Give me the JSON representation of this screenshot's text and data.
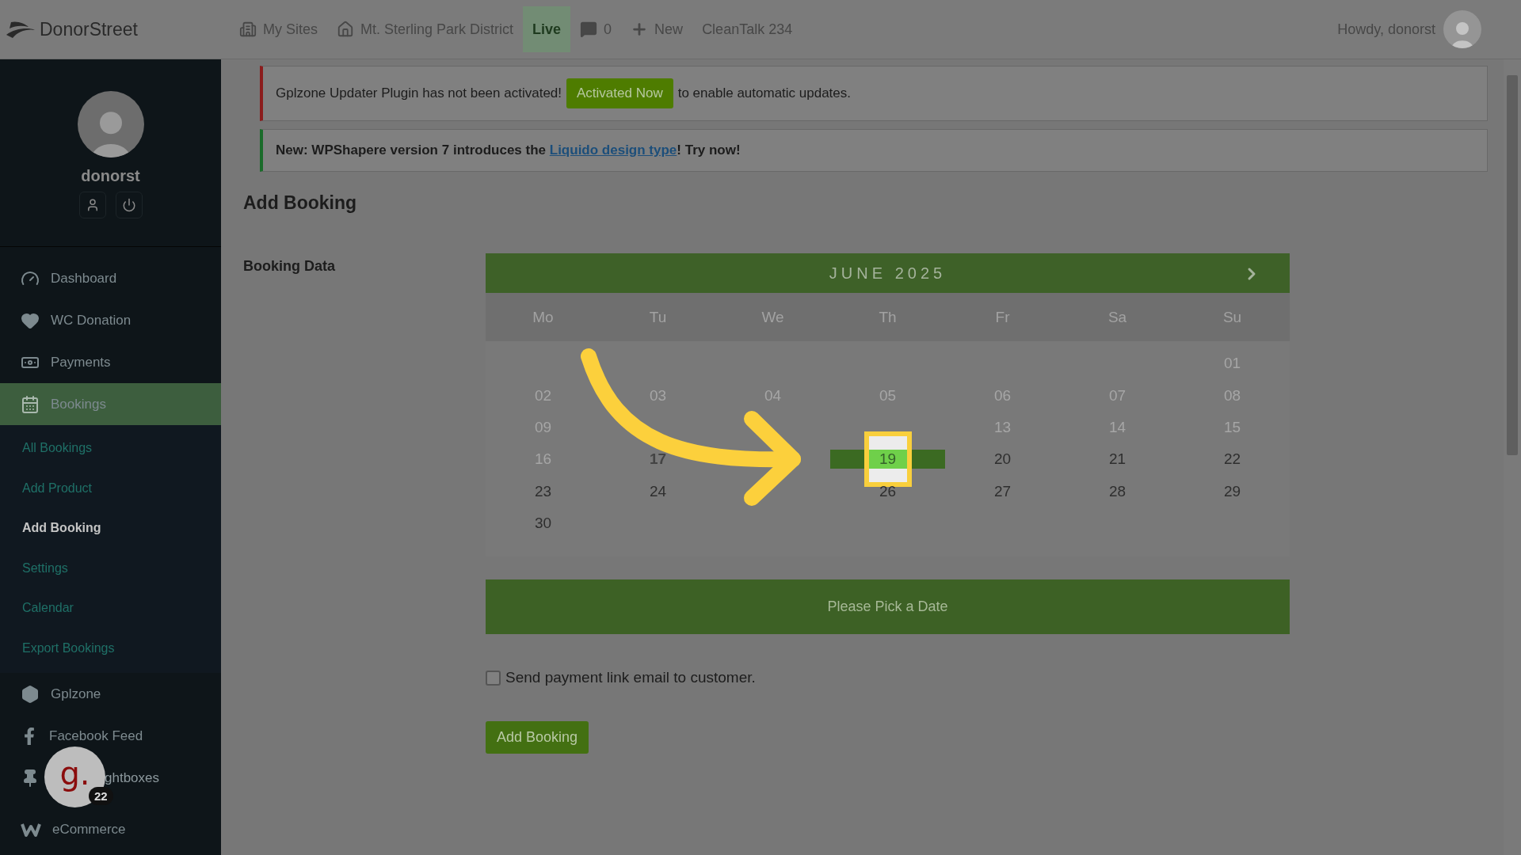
{
  "topbar": {
    "logo": "DonorStreet",
    "items": [
      {
        "kind": "sites",
        "label": "My Sites"
      },
      {
        "kind": "home",
        "label": "Mt. Sterling Park District"
      },
      {
        "kind": "live",
        "label": "Live"
      },
      {
        "kind": "comments",
        "label": "0"
      },
      {
        "kind": "new",
        "label": "New"
      },
      {
        "kind": "plain",
        "label": "CleanTalk 234"
      }
    ],
    "greeting": "Howdy, donorst"
  },
  "sidebar": {
    "username": "donorst",
    "items": [
      {
        "kind": "dashboard",
        "label": "Dashboard",
        "selected": false,
        "under_badge": false
      },
      {
        "kind": "heart",
        "label": "WC Donation",
        "selected": false,
        "under_badge": false
      },
      {
        "kind": "payments",
        "label": "Payments",
        "selected": false,
        "under_badge": false
      },
      {
        "kind": "calendar",
        "label": "Bookings",
        "selected": true,
        "under_badge": false,
        "children": [
          {
            "label": "All Bookings",
            "selected": false
          },
          {
            "label": "Add Product",
            "selected": false
          },
          {
            "label": "Add Booking",
            "selected": true
          },
          {
            "label": "Settings",
            "selected": false
          },
          {
            "label": "Calendar",
            "selected": false
          },
          {
            "label": "Export Bookings",
            "selected": false
          }
        ]
      },
      {
        "kind": "hexagon",
        "label": "Gplzone",
        "selected": false,
        "under_badge": false
      },
      {
        "kind": "facebook",
        "label": "Facebook Feed",
        "selected": false,
        "under_badge": false
      },
      {
        "kind": "pin",
        "label": "ghtboxes",
        "selected": false,
        "under_badge": true
      },
      {
        "kind": "woo",
        "label": "eCommerce",
        "selected": false,
        "under_badge": false
      }
    ]
  },
  "chat_bubble": {
    "logo": "g.",
    "badge": "22"
  },
  "notices": [
    {
      "kind": "error",
      "text": "Gplzone Updater Plugin has not been activated!",
      "button": "Activated Now",
      "after": "to enable automatic updates."
    },
    {
      "kind": "success",
      "text": "New: WPShapere version 7 introduces the ",
      "link": "Liquido design type",
      "after": "! Try now!"
    }
  ],
  "page": {
    "title": "Add Booking",
    "field_label": "Booking Data"
  },
  "calendar": {
    "month": "JUNE 2025",
    "weekdays": [
      "Mo",
      "Tu",
      "We",
      "Th",
      "Fr",
      "Sa",
      "Su"
    ],
    "weeks": [
      [
        {
          "kind": "blank"
        },
        {
          "kind": "blank"
        },
        {
          "kind": "blank"
        },
        {
          "kind": "blank"
        },
        {
          "kind": "blank"
        },
        {
          "kind": "blank"
        },
        {
          "kind": "day",
          "day": "01",
          "disabled": true,
          "today": false,
          "selected": false
        }
      ],
      [
        {
          "kind": "day",
          "day": "02",
          "disabled": true,
          "today": false,
          "selected": false
        },
        {
          "kind": "day",
          "day": "03",
          "disabled": true,
          "today": false,
          "selected": false
        },
        {
          "kind": "day",
          "day": "04",
          "disabled": true,
          "today": false,
          "selected": false
        },
        {
          "kind": "day",
          "day": "05",
          "disabled": true,
          "today": false,
          "selected": false
        },
        {
          "kind": "day",
          "day": "06",
          "disabled": true,
          "today": false,
          "selected": false
        },
        {
          "kind": "day",
          "day": "07",
          "disabled": true,
          "today": false,
          "selected": false
        },
        {
          "kind": "day",
          "day": "08",
          "disabled": true,
          "today": false,
          "selected": false
        }
      ],
      [
        {
          "kind": "day",
          "day": "09",
          "disabled": true,
          "today": false,
          "selected": false
        },
        {
          "kind": "blank"
        },
        {
          "kind": "blank"
        },
        {
          "kind": "blank"
        },
        {
          "kind": "day",
          "day": "13",
          "disabled": true,
          "today": false,
          "selected": false
        },
        {
          "kind": "day",
          "day": "14",
          "disabled": true,
          "today": false,
          "selected": false
        },
        {
          "kind": "day",
          "day": "15",
          "disabled": true,
          "today": false,
          "selected": false
        }
      ],
      [
        {
          "kind": "day",
          "day": "16",
          "disabled": true,
          "today": false,
          "selected": false
        },
        {
          "kind": "day",
          "day": "17",
          "disabled": false,
          "today": true,
          "selected": false
        },
        {
          "kind": "blank"
        },
        {
          "kind": "day",
          "day": "19",
          "disabled": false,
          "today": false,
          "selected": true
        },
        {
          "kind": "day",
          "day": "20",
          "disabled": false,
          "today": false,
          "selected": false
        },
        {
          "kind": "day",
          "day": "21",
          "disabled": false,
          "today": false,
          "selected": false
        },
        {
          "kind": "day",
          "day": "22",
          "disabled": false,
          "today": false,
          "selected": false
        }
      ],
      [
        {
          "kind": "day",
          "day": "23",
          "disabled": false,
          "today": false,
          "selected": false
        },
        {
          "kind": "day",
          "day": "24",
          "disabled": false,
          "today": false,
          "selected": false
        },
        {
          "kind": "blank"
        },
        {
          "kind": "day",
          "day": "26",
          "disabled": false,
          "today": false,
          "selected": false
        },
        {
          "kind": "day",
          "day": "27",
          "disabled": false,
          "today": false,
          "selected": false
        },
        {
          "kind": "day",
          "day": "28",
          "disabled": false,
          "today": false,
          "selected": false
        },
        {
          "kind": "day",
          "day": "29",
          "disabled": false,
          "today": false,
          "selected": false
        }
      ],
      [
        {
          "kind": "day",
          "day": "30",
          "disabled": false,
          "today": false,
          "selected": false
        },
        {
          "kind": "blank"
        },
        {
          "kind": "blank"
        },
        {
          "kind": "blank"
        },
        {
          "kind": "blank"
        },
        {
          "kind": "blank"
        },
        {
          "kind": "blank"
        }
      ]
    ]
  },
  "pick_date": "Please Pick a Date",
  "checkbox": {
    "label": "Send payment link email to customer.",
    "checked": false
  },
  "submit": "Add Booking"
}
